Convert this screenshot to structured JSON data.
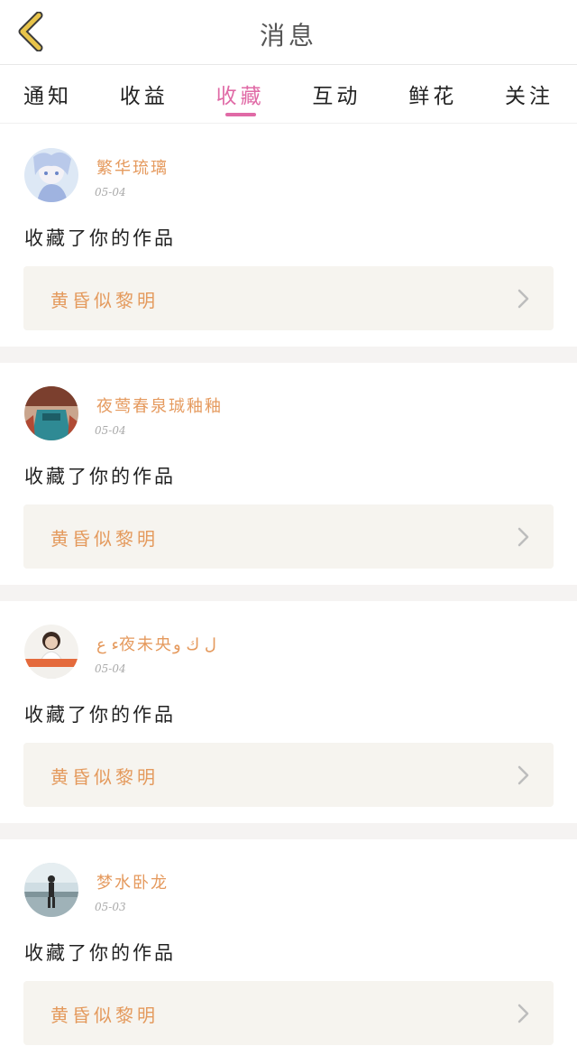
{
  "header": {
    "title": "消息",
    "back_icon": "chevron-left-icon"
  },
  "tabs": [
    {
      "label": "通知",
      "active": false
    },
    {
      "label": "收益",
      "active": false
    },
    {
      "label": "收藏",
      "active": true
    },
    {
      "label": "互动",
      "active": false
    },
    {
      "label": "鲜花",
      "active": false
    },
    {
      "label": "关注",
      "active": false
    }
  ],
  "colors": {
    "accent": "#e06aa6",
    "name": "#e59a5e",
    "work_bg": "#f6f4ef",
    "back_icon": "#e8c44a"
  },
  "items": [
    {
      "user": "繁华琉璃",
      "date": "05-04",
      "message": "收藏了你的作品",
      "work_title": "黄昏似黎明"
    },
    {
      "user": "夜莺春泉珹釉釉",
      "date": "05-04",
      "message": "收藏了你的作品",
      "work_title": "黄昏似黎明"
    },
    {
      "user": "ﺀ ﻉ夜未央ﻝ ﻙ ﻭ",
      "date": "05-04",
      "message": "收藏了你的作品",
      "work_title": "黄昏似黎明"
    },
    {
      "user": "梦水卧龙",
      "date": "05-03",
      "message": "收藏了你的作品",
      "work_title": "黄昏似黎明"
    }
  ]
}
